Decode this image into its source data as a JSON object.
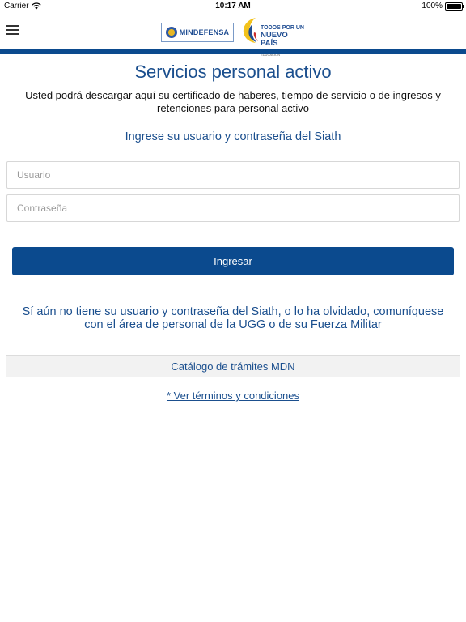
{
  "status_bar": {
    "carrier": "Carrier",
    "time": "10:17 AM",
    "battery": "100%",
    "wifi_icon": "wifi-icon",
    "battery_icon": "battery-icon"
  },
  "header": {
    "menu_icon": "hamburger-menu-icon",
    "logo_left_text": "MINDEFENSA",
    "logo_right_line1": "TODOS POR UN",
    "logo_right_line2": "NUEVO PAÍS",
    "logo_right_line3": "PAZ · EQUIDAD · EDUCACIÓN",
    "accent_color": "#0b4a8e"
  },
  "main": {
    "title": "Servicios personal activo",
    "description": "Usted podrá descargar aquí su certificado de haberes, tiempo de servicio o de ingresos y retenciones para personal activo",
    "subtitle": "Ingrese su usuario y contraseña del Siath",
    "username_placeholder": "Usuario",
    "username_value": "",
    "password_placeholder": "Contraseña",
    "password_value": "",
    "login_label": "Ingresar",
    "help_text": "Sí aún no tiene su usuario y contraseña del Siath, o lo ha olvidado, comuníquese con el área de personal de la UGG o de su Fuerza Militar",
    "catalog_label": "Catálogo de trámites MDN",
    "terms_label": "* Ver términos y condiciones"
  }
}
